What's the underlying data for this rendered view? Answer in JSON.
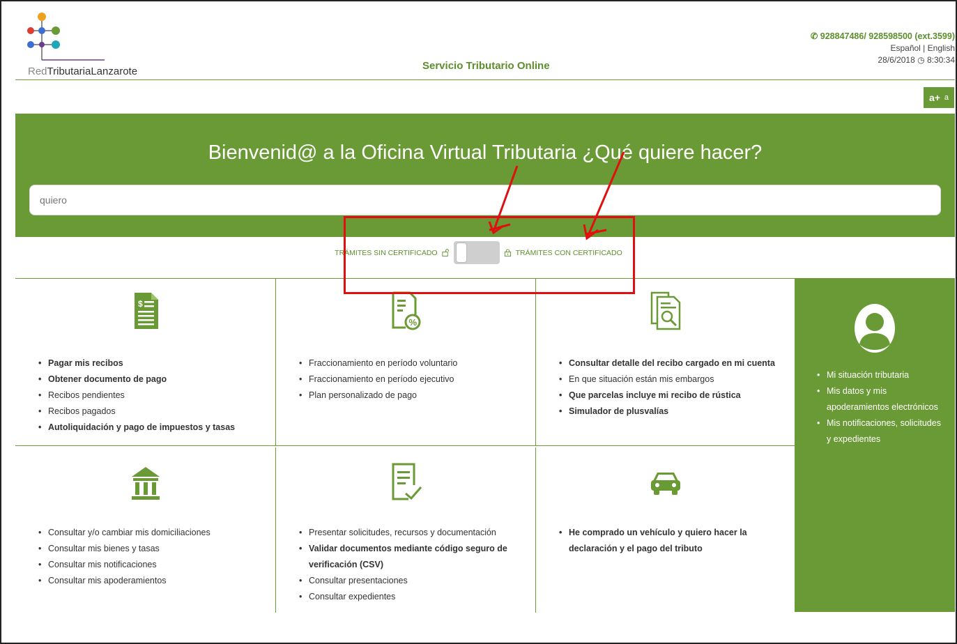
{
  "header": {
    "logo_red": "Red",
    "logo_main": "TributariaLanzarote",
    "title": "Servicio Tributario Online",
    "phone": "928847486/ 928598500 (ext.3599)",
    "lang_es": "Español",
    "lang_sep": " | ",
    "lang_en": "English",
    "date": "28/6/2018",
    "time": "8:30:34",
    "font_increase": "a+",
    "font_decrease": "a"
  },
  "hero": {
    "title": "Bienvenid@ a la Oficina Virtual Tributaria ¿Qué quiere hacer?",
    "search_placeholder": "quiero"
  },
  "toggle": {
    "left_label": "TRÁMITES SIN CERTIFICADO",
    "right_label": "TRÁMITES CON CERTIFICADO"
  },
  "cards": [
    {
      "icon": "receipt-icon",
      "items": [
        {
          "text": "Pagar mis recibos",
          "bold": true
        },
        {
          "text": "Obtener documento de pago",
          "bold": true
        },
        {
          "text": "Recibos pendientes",
          "bold": false
        },
        {
          "text": "Recibos pagados",
          "bold": false
        },
        {
          "text": "Autoliquidación y pago de impuestos y tasas",
          "bold": true
        }
      ]
    },
    {
      "icon": "installment-document-icon",
      "items": [
        {
          "text": "Fraccionamiento en período voluntario",
          "bold": false
        },
        {
          "text": "Fraccionamiento en período ejecutivo",
          "bold": false
        },
        {
          "text": "Plan personalizado de pago",
          "bold": false
        }
      ]
    },
    {
      "icon": "document-search-icon",
      "items": [
        {
          "text": "Consultar detalle del recibo cargado en mi cuenta",
          "bold": true
        },
        {
          "text": "En que situación están mis embargos",
          "bold": false
        },
        {
          "text": "Que parcelas incluye mi recibo de rústica",
          "bold": true
        },
        {
          "text": "Simulador de plusvalías",
          "bold": true
        }
      ]
    },
    {
      "icon": "bank-building-icon",
      "items": [
        {
          "text": "Consultar y/o cambiar mis domiciliaciones",
          "bold": false
        },
        {
          "text": "Consultar mis bienes y tasas",
          "bold": false
        },
        {
          "text": "Consultar mis notificaciones",
          "bold": false
        },
        {
          "text": "Consultar mis apoderamientos",
          "bold": false
        }
      ]
    },
    {
      "icon": "document-check-icon",
      "items": [
        {
          "text": "Presentar solicitudes, recursos y documentación",
          "bold": false
        },
        {
          "text": "Validar documentos mediante código seguro de verificación (CSV)",
          "bold": true
        },
        {
          "text": "Consultar presentaciones",
          "bold": false
        },
        {
          "text": "Consultar expedientes",
          "bold": false
        }
      ]
    },
    {
      "icon": "car-icon",
      "items": [
        {
          "text": "He comprado un vehículo y quiero hacer la declaración y el pago del tributo",
          "bold": true
        }
      ]
    }
  ],
  "side": {
    "icon": "user-avatar-icon",
    "items": [
      {
        "text": "Mi situación tributaria"
      },
      {
        "text": "Mis datos y mis apoderamientos electrónicos"
      },
      {
        "text": "Mis notificaciones, solicitudes y expedientes"
      }
    ]
  },
  "colors": {
    "brand_green": "#6a9a35",
    "annotation_red": "#e01010"
  }
}
